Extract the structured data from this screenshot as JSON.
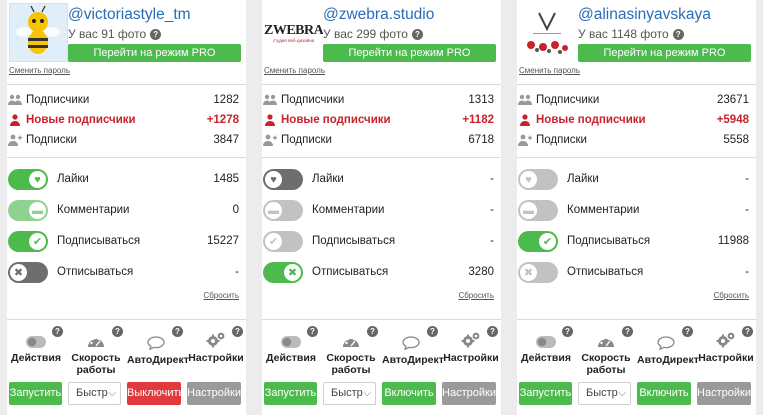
{
  "accounts": [
    {
      "username": "@victoriastyle_tm",
      "photos": "У вас 91 фото",
      "pro_button": "Перейти на режим PRO",
      "change_password": "Сменить пароль",
      "stats": [
        {
          "label": "Подписчики",
          "value": "1282",
          "icon": "users-icon"
        },
        {
          "label": "Новые подписчики",
          "value": "+1278",
          "icon": "new-user-icon"
        },
        {
          "label": "Подписки",
          "value": "3847",
          "icon": "add-user-icon"
        }
      ],
      "toggles": [
        {
          "label": "Лайки",
          "value": "1485",
          "state": "on"
        },
        {
          "label": "Комментарии",
          "value": "0",
          "state": "on-light"
        },
        {
          "label": "Подписываться",
          "value": "15227",
          "state": "on"
        },
        {
          "label": "Отписываться",
          "value": "-",
          "state": "off-dark"
        }
      ],
      "reset": "Сбросить",
      "tools": {
        "actions": "Действия",
        "speed": "Скорость работы",
        "autodirect": "АвтоДирект",
        "settings": "Настройки"
      },
      "buttons": {
        "start": "Запустить",
        "speed_value": "Быстр",
        "toggle": "Выключить",
        "settings": "Настройки"
      },
      "toggle_color": "#e0393e"
    },
    {
      "username": "@zwebra.studio",
      "photos": "У вас 299 фото",
      "pro_button": "Перейти на режим PRO",
      "change_password": "Сменить пароль",
      "logo_text": "ZWEBRA",
      "logo_sub": "студия веб-дизайна",
      "stats": [
        {
          "label": "Подписчики",
          "value": "1313",
          "icon": "users-icon"
        },
        {
          "label": "Новые подписчики",
          "value": "+1182",
          "icon": "new-user-icon"
        },
        {
          "label": "Подписки",
          "value": "6718",
          "icon": "add-user-icon"
        }
      ],
      "toggles": [
        {
          "label": "Лайки",
          "value": "-",
          "state": "off-dark"
        },
        {
          "label": "Комментарии",
          "value": "-",
          "state": "off"
        },
        {
          "label": "Подписываться",
          "value": "-",
          "state": "off"
        },
        {
          "label": "Отписываться",
          "value": "3280",
          "state": "on"
        }
      ],
      "reset": "Сбросить",
      "tools": {
        "actions": "Действия",
        "speed": "Скорость работы",
        "autodirect": "АвтоДирект",
        "settings": "Настройки"
      },
      "buttons": {
        "start": "Запустить",
        "speed_value": "Быстр",
        "toggle": "Включить",
        "settings": "Настройки"
      },
      "toggle_color": "#4cba4c"
    },
    {
      "username": "@alinasinyavskaya",
      "photos": "У вас 1148 фото",
      "pro_button": "Перейти на режим PRO",
      "change_password": "Сменить пароль",
      "stats": [
        {
          "label": "Подписчики",
          "value": "23671",
          "icon": "users-icon"
        },
        {
          "label": "Новые подписчики",
          "value": "+5948",
          "icon": "new-user-icon"
        },
        {
          "label": "Подписки",
          "value": "5558",
          "icon": "add-user-icon"
        }
      ],
      "toggles": [
        {
          "label": "Лайки",
          "value": "-",
          "state": "off"
        },
        {
          "label": "Комментарии",
          "value": "-",
          "state": "off"
        },
        {
          "label": "Подписываться",
          "value": "11988",
          "state": "on"
        },
        {
          "label": "Отписываться",
          "value": "-",
          "state": "off"
        }
      ],
      "reset": "Сбросить",
      "tools": {
        "actions": "Действия",
        "speed": "Скорость работы",
        "autodirect": "АвтоДирект",
        "settings": "Настройки"
      },
      "buttons": {
        "start": "Запустить",
        "speed_value": "Быстр",
        "toggle": "Включить",
        "settings": "Настройки"
      },
      "toggle_color": "#4cba4c"
    }
  ]
}
